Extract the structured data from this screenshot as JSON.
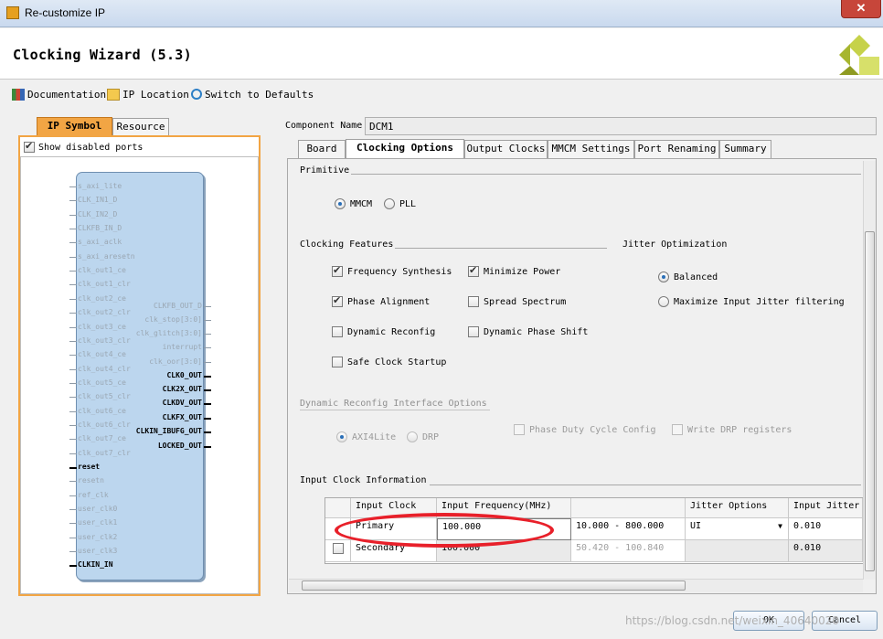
{
  "window": {
    "title": "Re-customize IP",
    "close_glyph": "✕"
  },
  "header": {
    "wizard_title": "Clocking Wizard (5.3)",
    "logo_icon": "xilinx-logo"
  },
  "toolbar": {
    "documentation": "Documentation",
    "ip_location": "IP Location",
    "switch_defaults": "Switch to Defaults"
  },
  "left_panel": {
    "tabs": [
      "IP Symbol",
      "Resource"
    ],
    "show_disabled_ports": "Show disabled ports",
    "left_ports": [
      "s_axi_lite",
      "CLK_IN1_D",
      "CLK_IN2_D",
      "CLKFB_IN_D",
      "s_axi_aclk",
      "s_axi_aresetn",
      "clk_out1_ce",
      "clk_out1_clr",
      "clk_out2_ce",
      "clk_out2_clr",
      "clk_out3_ce",
      "clk_out3_clr",
      "clk_out4_ce",
      "clk_out4_clr",
      "clk_out5_ce",
      "clk_out5_clr",
      "clk_out6_ce",
      "clk_out6_clr",
      "clk_out7_ce",
      "clk_out7_clr",
      "reset",
      "resetn",
      "ref_clk",
      "user_clk0",
      "user_clk1",
      "user_clk2",
      "user_clk3",
      "CLKIN_IN"
    ],
    "right_ports": [
      "CLKFB_OUT_D",
      "clk_stop[3:0]",
      "clk_glitch[3:0]",
      "interrupt",
      "clk_oor[3:0]",
      "CLK0_OUT",
      "CLK2X_OUT",
      "CLKDV_OUT",
      "CLKFX_OUT",
      "CLKIN_IBUFG_OUT",
      "LOCKED_OUT"
    ]
  },
  "component": {
    "label": "Component Name",
    "value": "DCM1"
  },
  "tabs": [
    "Board",
    "Clocking Options",
    "Output Clocks",
    "MMCM Settings",
    "Port Renaming",
    "Summary"
  ],
  "primitive": {
    "title": "Primitive",
    "options": [
      "MMCM",
      "PLL"
    ],
    "selected": "MMCM"
  },
  "clocking_features": {
    "title": "Clocking Features",
    "frequency_synthesis": "Frequency Synthesis",
    "minimize_power": "Minimize Power",
    "phase_alignment": "Phase Alignment",
    "spread_spectrum": "Spread Spectrum",
    "dynamic_reconfig": "Dynamic Reconfig",
    "dynamic_phase_shift": "Dynamic Phase Shift",
    "safe_clock_startup": "Safe Clock Startup"
  },
  "jitter": {
    "title": "Jitter Optimization",
    "balanced": "Balanced",
    "maximize": "Maximize Input Jitter filtering"
  },
  "dynamic_reconfig": {
    "title": "Dynamic Reconfig Interface Options",
    "axi4lite": "AXI4Lite",
    "drp": "DRP",
    "phase_duty": "Phase Duty Cycle Config",
    "write_drp": "Write DRP registers"
  },
  "input_clock": {
    "title": "Input Clock Information",
    "headers": [
      "Input Clock",
      "Input Frequency(MHz)",
      "",
      "Jitter Options",
      "Input Jitter"
    ],
    "rows": [
      {
        "name": "Primary",
        "freq": "100.000",
        "range": "10.000 - 800.000",
        "jitter_opt": "UI",
        "jitter": "0.010"
      },
      {
        "name": "Secondary",
        "freq": "100.000",
        "range": "50.420 - 100.840",
        "jitter_opt": "",
        "jitter": "0.010"
      }
    ]
  },
  "buttons": {
    "ok": "OK",
    "cancel": "Cancel"
  },
  "watermark": "https://blog.csdn.net/weixin_40640020"
}
